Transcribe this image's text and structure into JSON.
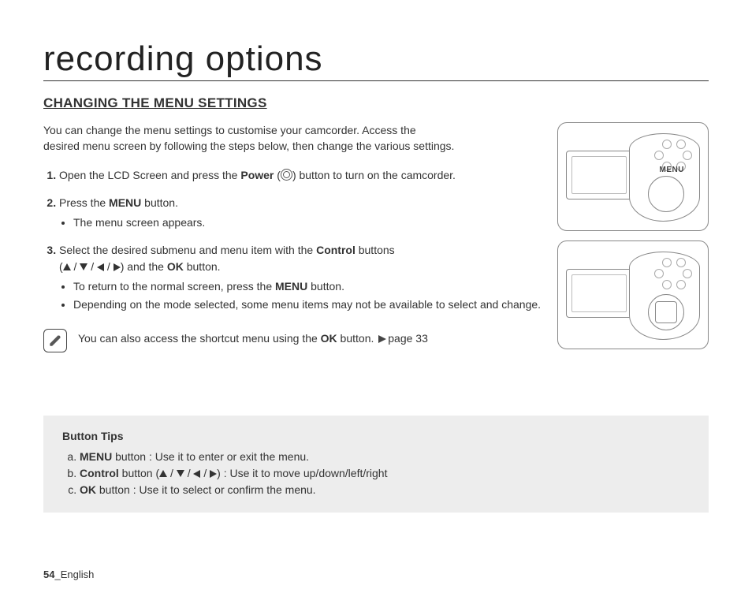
{
  "title": "recording options",
  "subtitle": "CHANGING THE MENU SETTINGS",
  "intro_line1": "You can change the menu settings to customise your camcorder. Access the",
  "intro_line2": "desired menu screen by following the steps below, then change the various settings.",
  "steps": {
    "s1_a": "Open the LCD Screen and press the ",
    "s1_power": "Power",
    "s1_b": " (",
    "s1_c": ") button to turn on the camcorder.",
    "s2_a": "Press the ",
    "s2_menu": "MENU",
    "s2_b": " button.",
    "s2_sub1": "The menu screen appears.",
    "s3_a": "Select the desired submenu and menu item with the ",
    "s3_control": "Control",
    "s3_b": " buttons",
    "s3_c": "(",
    "s3_slash": " / ",
    "s3_d": ") and the ",
    "s3_ok": "OK",
    "s3_e": " button.",
    "s3_sub1_a": "To return to the normal screen, press the ",
    "s3_sub1_menu": "MENU",
    "s3_sub1_b": " button.",
    "s3_sub2": "Depending on the mode selected, some menu items may not be available to select and change."
  },
  "note": {
    "text_a": "You can also access the shortcut menu using the ",
    "ok": "OK",
    "text_b": " button. ",
    "page_ref": "page 33"
  },
  "diagram": {
    "menu_label": "MENU"
  },
  "tips": {
    "title": "Button Tips",
    "a_menu": "MENU",
    "a_text": " button : Use it to enter or exit the menu.",
    "b_control": "Control",
    "b_text_a": " button (",
    "b_slash": " / ",
    "b_text_b": ") : Use it to move up/down/left/right",
    "c_ok": "OK",
    "c_text": " button : Use it to select or confirm the menu."
  },
  "footer": {
    "page_num": "54",
    "lang": "_English"
  }
}
